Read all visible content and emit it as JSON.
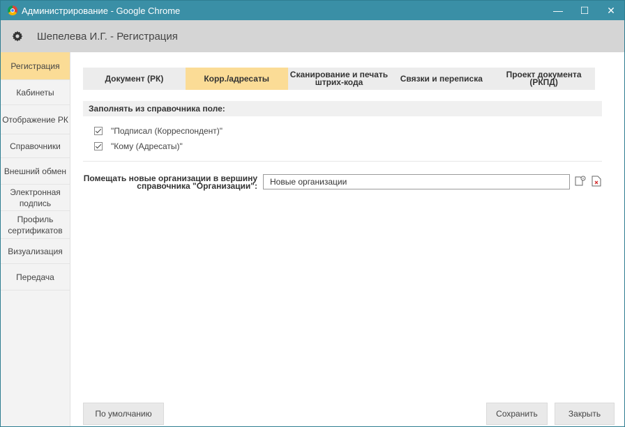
{
  "window": {
    "title": "Администрирование - Google Chrome",
    "controls": {
      "minimize": "—",
      "maximize": "☐",
      "close": "✕"
    }
  },
  "app": {
    "title": "Шепелева И.Г. - Регистрация"
  },
  "sidebar": {
    "items": [
      {
        "label": "Регистрация",
        "active": true
      },
      {
        "label": "Кабинеты"
      },
      {
        "label": "Отображение РК"
      },
      {
        "label": "Справочники"
      },
      {
        "label": "Внешний обмен"
      },
      {
        "label": "Электронная подпись"
      },
      {
        "label": "Профиль сертификатов"
      },
      {
        "label": "Визуализация"
      },
      {
        "label": "Передача"
      }
    ]
  },
  "tabs": [
    {
      "label": "Документ (РК)"
    },
    {
      "label": "Корр./адресаты",
      "active": true
    },
    {
      "label": "Сканирование и печать штрих-кода"
    },
    {
      "label": "Связки и переписка"
    },
    {
      "label": "Проект документа (РКПД)"
    }
  ],
  "section": {
    "header": "Заполнять из справочника поле:",
    "checkboxes": [
      {
        "label": "\"Подписал (Корреспондент)\"",
        "checked": true
      },
      {
        "label": "\"Кому (Адресаты)\"",
        "checked": true
      }
    ]
  },
  "org_field": {
    "label": "Помещать новые организации в вершину справочника \"Организации\":",
    "value": "Новые организации"
  },
  "buttons": {
    "default": "По умолчанию",
    "save": "Сохранить",
    "close": "Закрыть"
  },
  "colors": {
    "titlebar": "#3a8fa6",
    "accent": "#fbdc96",
    "appbar": "#d5d5d5"
  }
}
